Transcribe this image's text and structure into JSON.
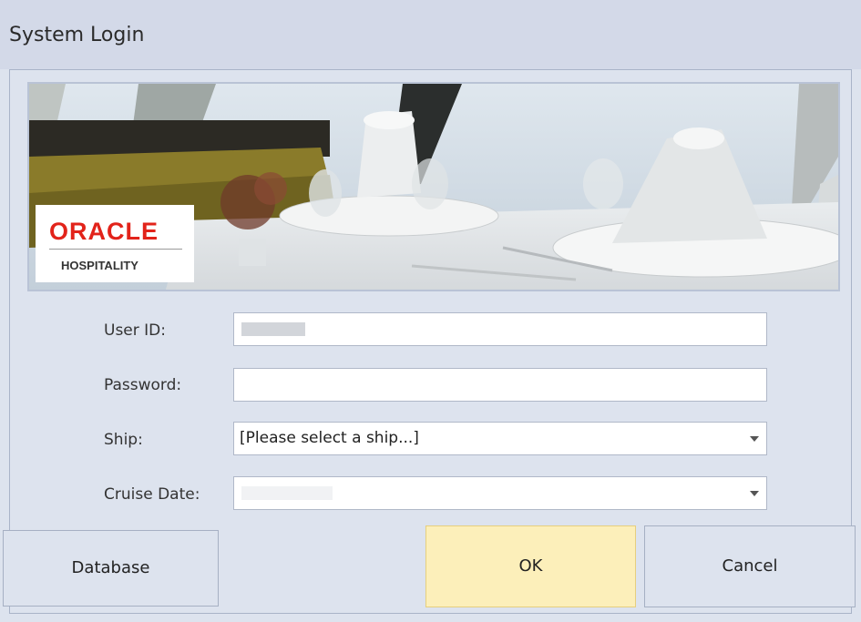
{
  "window": {
    "title": "System Login"
  },
  "banner": {
    "logo": {
      "brand": "ORACLE",
      "tagline": "HOSPITALITY"
    }
  },
  "form": {
    "user_id": {
      "label": "User ID:",
      "value": ""
    },
    "password": {
      "label": "Password:",
      "value": ""
    },
    "ship": {
      "label": "Ship:",
      "value": "[Please select a ship...]"
    },
    "cruise_date": {
      "label": "Cruise Date:",
      "value": ""
    }
  },
  "buttons": {
    "database": "Database",
    "ok": "OK",
    "cancel": "Cancel"
  },
  "colors": {
    "window_bg": "#dde3ee",
    "ok_button_bg": "#fcefba",
    "brand_red": "#e2231a"
  },
  "icons": [
    "dropdown-arrow-icon"
  ]
}
